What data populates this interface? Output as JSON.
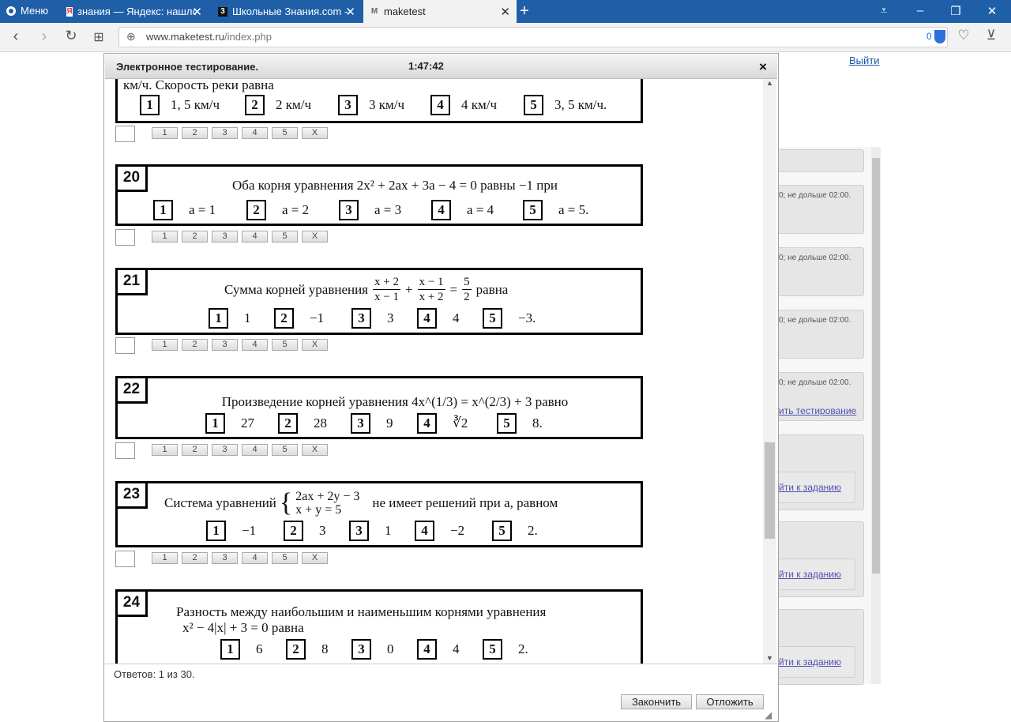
{
  "browser": {
    "menu_label": "Меню",
    "tabs": [
      {
        "label": "знания — Яндекс: нашлос",
        "icon": "yandex-icon"
      },
      {
        "label": "Школьные Знания.com - (",
        "icon": "znanija-icon"
      },
      {
        "label": "maketest",
        "icon": "gmail-icon"
      }
    ],
    "url_host": "www.maketest.ru",
    "url_path": "/index.php",
    "adblock_count": "0"
  },
  "page": {
    "logout_label": "Выйти",
    "side_text": "0; не дольше 02:00.",
    "side_link_finish": "ить тестирование",
    "side_link_goto": "йти к заданию"
  },
  "dialog": {
    "title": "Электронное тестирование.",
    "timer": "1:47:42",
    "close_label": "×",
    "answers_text": "Ответов: 1 из 30.",
    "finish_label": "Закончить",
    "postpone_label": "Отложить"
  },
  "answer_buttons": [
    "1",
    "2",
    "3",
    "4",
    "5",
    "X"
  ],
  "questions": [
    {
      "num": "",
      "text": "км/ч. Скорость реки равна",
      "options": [
        {
          "n": "1",
          "v": "1, 5 км/ч"
        },
        {
          "n": "2",
          "v": "2 км/ч"
        },
        {
          "n": "3",
          "v": "3 км/ч"
        },
        {
          "n": "4",
          "v": "4 км/ч"
        },
        {
          "n": "5",
          "v": "3, 5 км/ч."
        }
      ]
    },
    {
      "num": "20",
      "text": "Оба корня уравнения 2x² + 2ax + 3a − 4 = 0 равны −1 при",
      "options": [
        {
          "n": "1",
          "v": "a = 1"
        },
        {
          "n": "2",
          "v": "a = 2"
        },
        {
          "n": "3",
          "v": "a = 3"
        },
        {
          "n": "4",
          "v": "a = 4"
        },
        {
          "n": "5",
          "v": "a = 5."
        }
      ]
    },
    {
      "num": "21",
      "text": "Сумма корней уравнения",
      "text_after": "равна",
      "frac1_num": "x + 2",
      "frac1_den": "x − 1",
      "frac2_num": "x − 1",
      "frac2_den": "x + 2",
      "frac3_num": "5",
      "frac3_den": "2",
      "options": [
        {
          "n": "1",
          "v": "1"
        },
        {
          "n": "2",
          "v": "−1"
        },
        {
          "n": "3",
          "v": "3"
        },
        {
          "n": "4",
          "v": "4"
        },
        {
          "n": "5",
          "v": "−3."
        }
      ]
    },
    {
      "num": "22",
      "text": "Произведение корней уравнения 4x^(1/3) = x^(2/3) + 3 равно",
      "options": [
        {
          "n": "1",
          "v": "27"
        },
        {
          "n": "2",
          "v": "28"
        },
        {
          "n": "3",
          "v": "9"
        },
        {
          "n": "4",
          "v": "∛2"
        },
        {
          "n": "5",
          "v": "8."
        }
      ]
    },
    {
      "num": "23",
      "text": "Система уравнений",
      "sys1": "2ax + 2y − 3",
      "sys2": "x + y = 5",
      "text_after": "не имеет решений при a, равном",
      "options": [
        {
          "n": "1",
          "v": "−1"
        },
        {
          "n": "2",
          "v": "3"
        },
        {
          "n": "3",
          "v": "1"
        },
        {
          "n": "4",
          "v": "−2"
        },
        {
          "n": "5",
          "v": "2."
        }
      ]
    },
    {
      "num": "24",
      "text": "Разность между наибольшим и наименьшим корнями уравнения",
      "text2": "x² − 4|x| + 3 = 0 равна",
      "options": [
        {
          "n": "1",
          "v": "6"
        },
        {
          "n": "2",
          "v": "8"
        },
        {
          "n": "3",
          "v": "0"
        },
        {
          "n": "4",
          "v": "4"
        },
        {
          "n": "5",
          "v": "2."
        }
      ]
    }
  ]
}
